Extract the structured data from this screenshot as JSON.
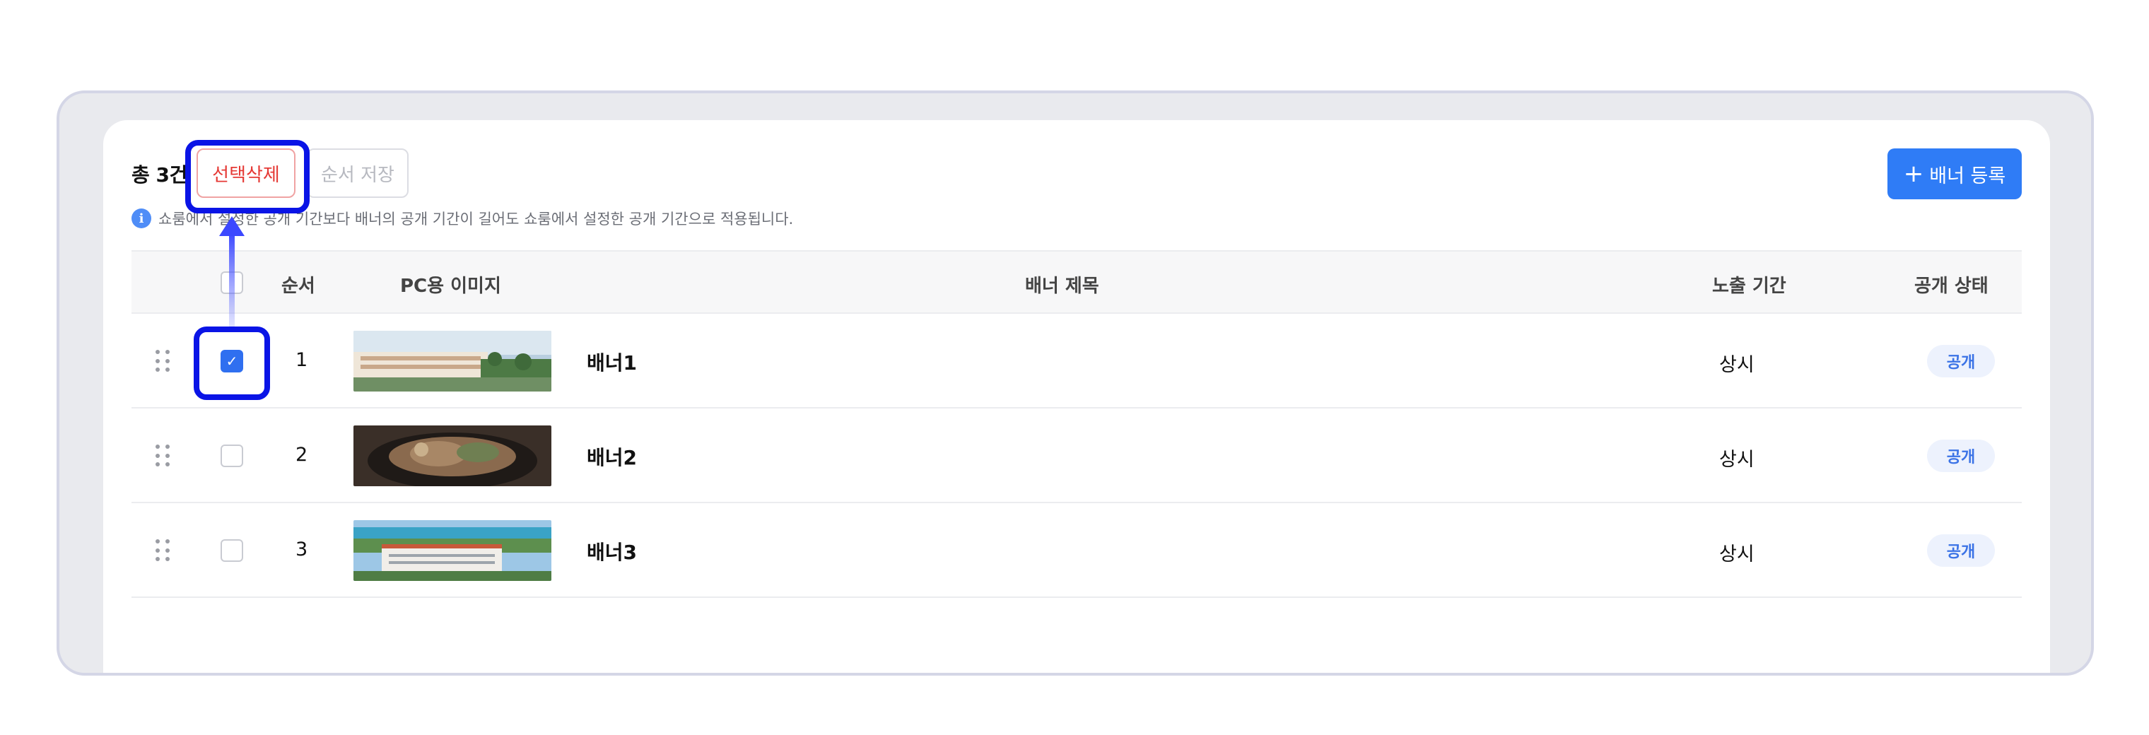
{
  "toolbar": {
    "total_label": "총 3건",
    "delete_label": "선택삭제",
    "save_order_label": "순서 저장",
    "add_banner_label": "배너 등록",
    "add_icon": "plus-icon"
  },
  "notice": {
    "icon": "info-icon",
    "icon_glyph": "i",
    "text": "쇼룸에서 설정한 공개 기간보다 배너의 공개 기간이 길어도 쇼룸에서 설정한 공개 기간으로 적용됩니다."
  },
  "table": {
    "columns": [
      "순서",
      "PC용 이미지",
      "배너 제목",
      "노출 기간",
      "공개 상태"
    ],
    "rows": [
      {
        "order": "1",
        "title": "배너1",
        "period": "상시",
        "status": "공개",
        "checked": true
      },
      {
        "order": "2",
        "title": "배너2",
        "period": "상시",
        "status": "공개",
        "checked": false
      },
      {
        "order": "3",
        "title": "배너3",
        "period": "상시",
        "status": "공개",
        "checked": false
      }
    ]
  },
  "colors": {
    "accent": "#2f7cf6",
    "danger": "#e53935",
    "highlight": "#0a14e6",
    "badge_bg": "#edf2fd"
  }
}
